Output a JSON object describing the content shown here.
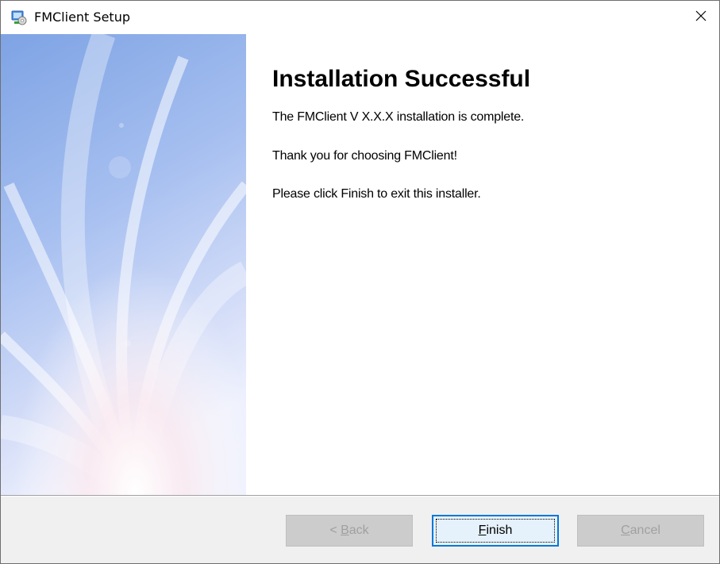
{
  "window": {
    "title": "FMClient Setup",
    "app_icon": "installer-icon",
    "close_icon": "close-icon"
  },
  "content": {
    "heading": "Installation Successful",
    "line1": "The FMClient V X.X.X  installation is complete.",
    "line2": "Thank you for choosing FMClient!",
    "line3": "Please click Finish to exit this installer."
  },
  "buttons": {
    "back": {
      "prefix": "< ",
      "accel": "B",
      "rest": "ack",
      "enabled": false
    },
    "finish": {
      "prefix": "",
      "accel": "F",
      "rest": "inish",
      "enabled": true,
      "default": true
    },
    "cancel": {
      "prefix": "",
      "accel": "C",
      "rest": "ancel",
      "enabled": false
    }
  },
  "colors": {
    "banner_top": "#7fa6e6",
    "banner_bottom": "#e9eefc",
    "accent": "#0078d7",
    "footer_bg": "#f0f0f0"
  }
}
